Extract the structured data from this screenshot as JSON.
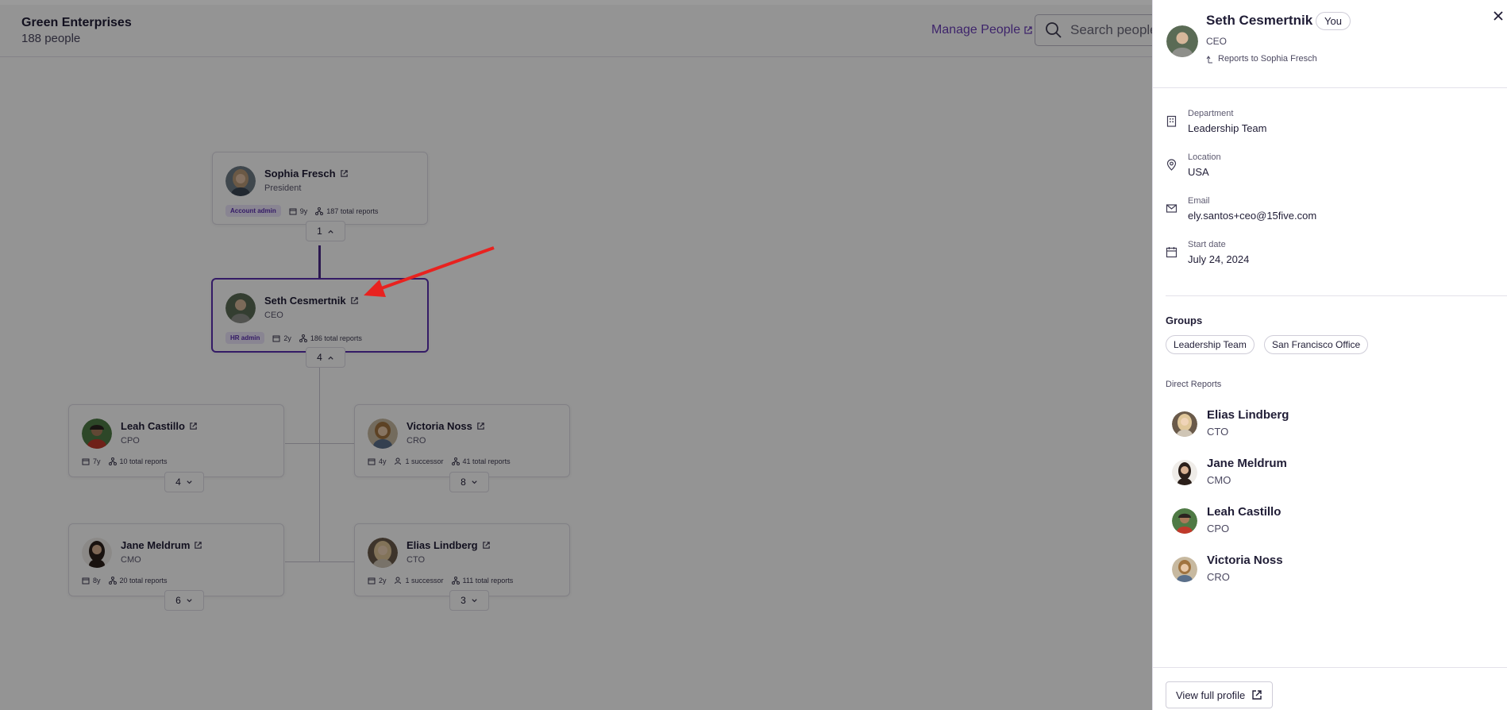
{
  "header": {
    "org_name": "Green Enterprises",
    "people_count": "188 people",
    "manage_people": "Manage People",
    "search_placeholder": "Search people..."
  },
  "cards": {
    "sophia": {
      "name": "Sophia Fresch",
      "role": "President",
      "badge": "Account admin",
      "tenure": "9y",
      "reports": "187 total reports",
      "toggle": "1"
    },
    "seth": {
      "name": "Seth Cesmertnik",
      "role": "CEO",
      "badge": "HR admin",
      "tenure": "2y",
      "reports": "186 total reports",
      "toggle": "4"
    },
    "leah": {
      "name": "Leah Castillo",
      "role": "CPO",
      "tenure": "7y",
      "reports": "10 total reports",
      "toggle": "4"
    },
    "victoria": {
      "name": "Victoria Noss",
      "role": "CRO",
      "tenure": "4y",
      "successor": "1 successor",
      "reports": "41 total reports",
      "toggle": "8"
    },
    "jane": {
      "name": "Jane Meldrum",
      "role": "CMO",
      "tenure": "8y",
      "reports": "20 total reports",
      "toggle": "6"
    },
    "elias": {
      "name": "Elias Lindberg",
      "role": "CTO",
      "tenure": "2y",
      "successor": "1 successor",
      "reports": "111 total reports",
      "toggle": "3"
    }
  },
  "panel": {
    "name": "Seth Cesmertnik",
    "you": "You",
    "role": "CEO",
    "reports_to": "Reports to Sophia Fresch",
    "details": [
      {
        "label": "Department",
        "value": "Leadership Team",
        "icon": "building-icon"
      },
      {
        "label": "Location",
        "value": "USA",
        "icon": "location-pin-icon"
      },
      {
        "label": "Email",
        "value": "ely.santos+ceo@15five.com",
        "icon": "mail-icon"
      },
      {
        "label": "Start date",
        "value": "July 24, 2024",
        "icon": "calendar-icon"
      }
    ],
    "groups_title": "Groups",
    "groups": [
      "Leadership Team",
      "San Francisco Office"
    ],
    "direct_reports_title": "Direct Reports",
    "direct_reports": [
      {
        "name": "Elias Lindberg",
        "role": "CTO"
      },
      {
        "name": "Jane Meldrum",
        "role": "CMO"
      },
      {
        "name": "Leah Castillo",
        "role": "CPO"
      },
      {
        "name": "Victoria Noss",
        "role": "CRO"
      }
    ],
    "view_full_profile": "View full profile"
  },
  "colors": {
    "accent": "#5a2fb0",
    "link": "#6b3fb8",
    "annotation_arrow": "#e8221f",
    "overlay": "#000000"
  }
}
